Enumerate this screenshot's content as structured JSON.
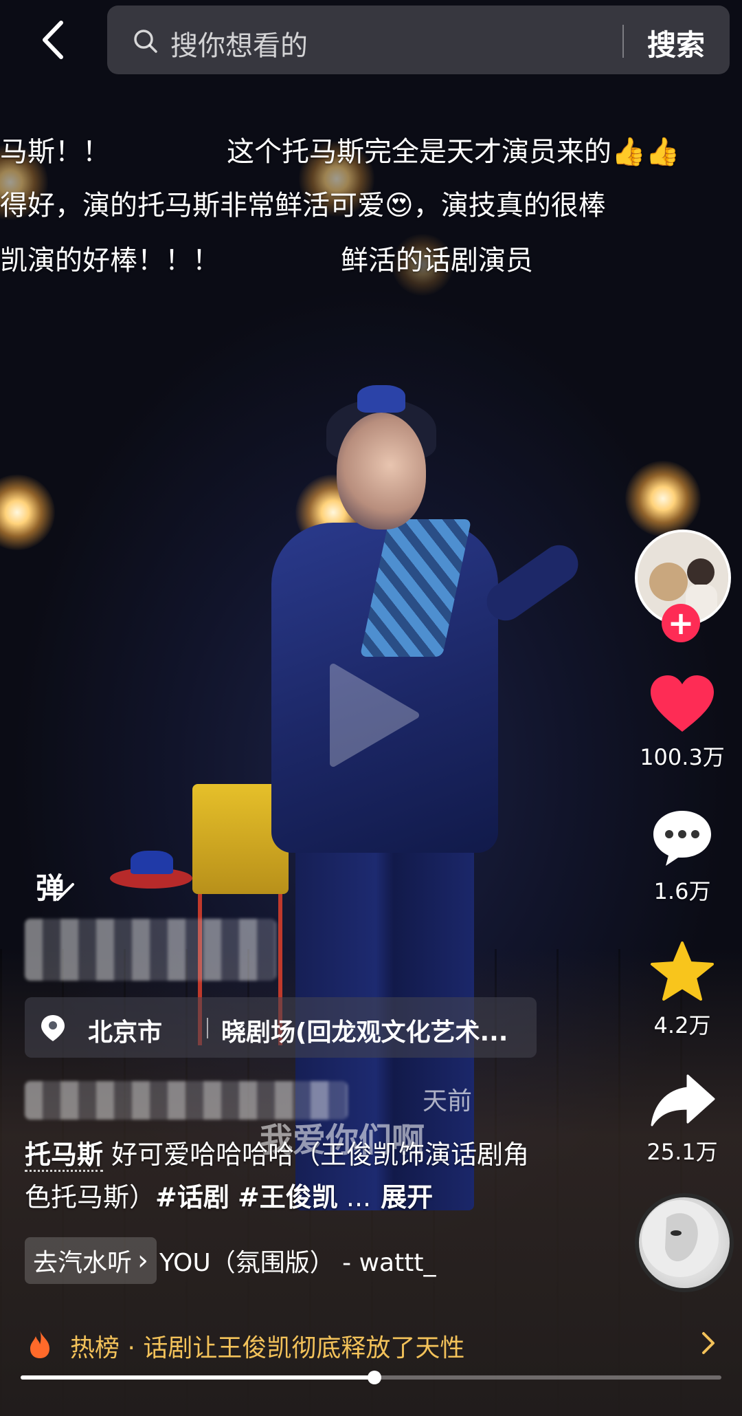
{
  "search": {
    "placeholder": "搜你想看的",
    "button_label": "搜索"
  },
  "danmaku": [
    "马斯！！",
    "这个托马斯完全是天才演员来的👍👍",
    "得好，演的托马斯非常鲜活可爱😍，演技真的很棒",
    "凯演的好棒！！！",
    "鲜活的话剧演员"
  ],
  "actions": {
    "like_count": "100.3万",
    "comment_count": "1.6万",
    "favorite_count": "4.2万",
    "share_count": "25.1万",
    "follow_symbol": "+"
  },
  "danmaku_toggle_label": "弹",
  "location": {
    "city": "北京市",
    "venue": "晓剧场(回龙观文化艺术..."
  },
  "time_ago": "天前",
  "overlay_caption": "我爱你们啊",
  "description": {
    "author": "托马斯",
    "text": " 好可爱哈哈哈哈（王俊凯饰演话剧角色托马斯）",
    "tag1": "#话剧",
    "tag2": "#王俊凯",
    "ellipsis": " ...",
    "expand_label": "展开"
  },
  "music": {
    "chip_label": "去汽水听",
    "chip_arrow": "›",
    "title": "YOU（氛围版） - wattt_"
  },
  "hot": {
    "label": "热榜",
    "dot": " · ",
    "topic": "话剧让王俊凯彻底释放了天性"
  },
  "progress": {
    "fraction": 0.505
  },
  "colors": {
    "like": "#fe2c55",
    "favorite": "#f8c51c",
    "hot_text": "#f3c25a",
    "follow": "#fe2c55"
  }
}
